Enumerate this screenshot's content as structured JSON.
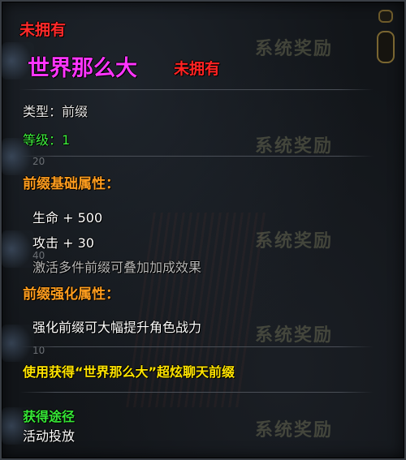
{
  "header": {
    "status": "未拥有"
  },
  "item": {
    "name": "世界那么大",
    "name_status": "未拥有",
    "type_line": "类型：前缀",
    "level_line": "等级：1",
    "name_color": "#ff35ff"
  },
  "base_attributes": {
    "title": "前缀基础属性：",
    "stats": [
      "生命 + 500",
      "攻击 + 30"
    ],
    "note": "激活多件前缀可叠加加成效果"
  },
  "enhance_attributes": {
    "title": "前缀强化属性：",
    "desc": "强化前缀可大幅提升角色战力"
  },
  "usage": {
    "text": "使用获得“世界那么大”超炫聊天前缀"
  },
  "source": {
    "title": "获得途径",
    "value": "活动投放"
  },
  "background": {
    "watermark": "系统奖励",
    "levels": [
      "20",
      "40",
      "10"
    ]
  },
  "colors": {
    "status_red": "#ff2a2a",
    "level_green": "#3ef03e",
    "section_orange": "#ff9d1e",
    "usage_yellow": "#ffe400"
  }
}
